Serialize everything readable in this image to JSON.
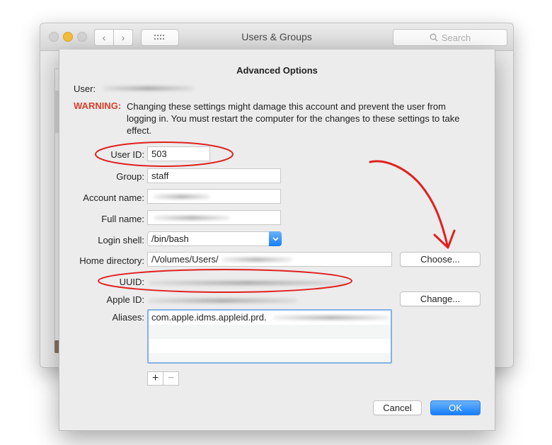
{
  "window": {
    "title": "Users & Groups",
    "search_placeholder": "Search",
    "back_glyph": "‹",
    "forward_glyph": "›"
  },
  "sheet": {
    "title": "Advanced Options",
    "user_label": "User:",
    "warning_label": "WARNING:",
    "warning_text": "Changing these settings might damage this account and prevent the user from logging in. You must restart the computer for the changes to these settings to take effect.",
    "fields": {
      "user_id_label": "User ID:",
      "user_id_value": "503",
      "group_label": "Group:",
      "group_value": "staff",
      "account_name_label": "Account name:",
      "full_name_label": "Full name:",
      "login_shell_label": "Login shell:",
      "login_shell_value": "/bin/bash",
      "home_directory_label": "Home directory:",
      "home_directory_value": "/Volumes/Users/",
      "uuid_label": "UUID:",
      "apple_id_label": "Apple ID:",
      "aliases_label": "Aliases:",
      "alias_value": "com.apple.idms.appleid.prd."
    },
    "buttons": {
      "choose": "Choose...",
      "change": "Change...",
      "cancel": "Cancel",
      "ok": "OK",
      "add": "+",
      "remove": "−"
    }
  },
  "colors": {
    "warning": "#d6402a",
    "accent": "#167efb",
    "annotation": "#e02020"
  }
}
